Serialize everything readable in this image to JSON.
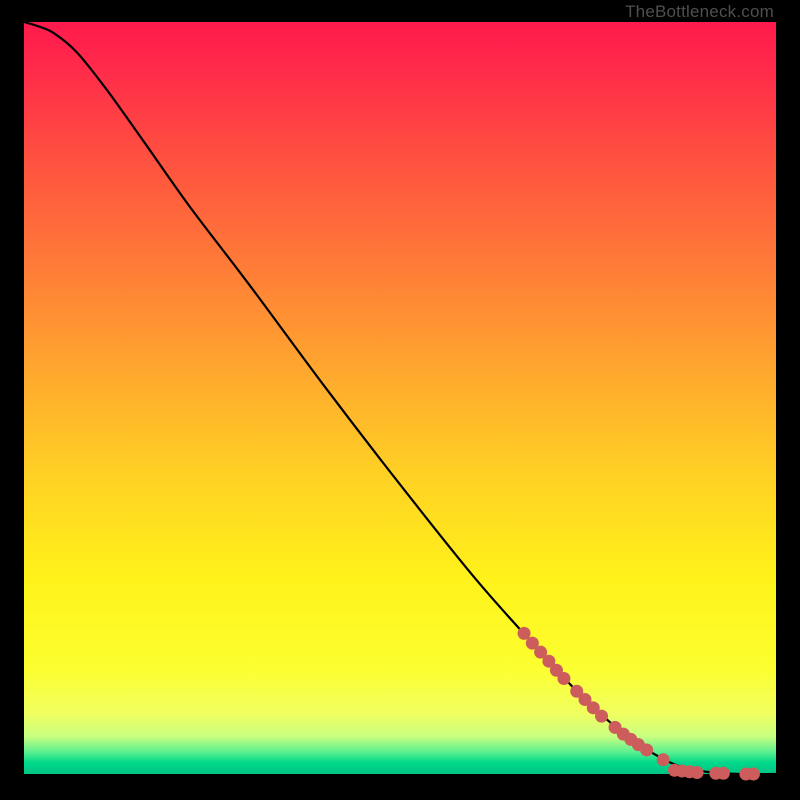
{
  "attribution": "TheBottleneck.com",
  "colors": {
    "marker": "#cd5c5c",
    "curve": "#000000",
    "gradient_top": "#ff1a4d",
    "gradient_bottom": "#00c484",
    "background": "#000000"
  },
  "chart_data": {
    "type": "line",
    "title": "",
    "xlabel": "",
    "ylabel": "",
    "xlim": [
      0,
      100
    ],
    "ylim": [
      0,
      100
    ],
    "grid": false,
    "legend": false,
    "curve_points": [
      {
        "x": 0.0,
        "y": 100.0
      },
      {
        "x": 2.0,
        "y": 99.4
      },
      {
        "x": 4.0,
        "y": 98.5
      },
      {
        "x": 7.0,
        "y": 96.0
      },
      {
        "x": 11.0,
        "y": 91.0
      },
      {
        "x": 16.0,
        "y": 84.0
      },
      {
        "x": 22.0,
        "y": 75.5
      },
      {
        "x": 30.0,
        "y": 65.0
      },
      {
        "x": 40.0,
        "y": 51.5
      },
      {
        "x": 50.0,
        "y": 38.5
      },
      {
        "x": 60.0,
        "y": 26.0
      },
      {
        "x": 68.0,
        "y": 17.0
      },
      {
        "x": 75.0,
        "y": 9.5
      },
      {
        "x": 81.0,
        "y": 4.5
      },
      {
        "x": 86.0,
        "y": 1.5
      },
      {
        "x": 90.0,
        "y": 0.4
      },
      {
        "x": 95.0,
        "y": 0.0
      },
      {
        "x": 100.0,
        "y": 0.0
      }
    ],
    "markers": [
      {
        "x": 66.5,
        "y": 18.7
      },
      {
        "x": 67.6,
        "y": 17.4
      },
      {
        "x": 68.7,
        "y": 16.2
      },
      {
        "x": 69.8,
        "y": 15.0
      },
      {
        "x": 70.8,
        "y": 13.8
      },
      {
        "x": 71.8,
        "y": 12.7
      },
      {
        "x": 73.5,
        "y": 11.0
      },
      {
        "x": 74.6,
        "y": 9.9
      },
      {
        "x": 75.7,
        "y": 8.8
      },
      {
        "x": 76.8,
        "y": 7.7
      },
      {
        "x": 78.6,
        "y": 6.2
      },
      {
        "x": 79.7,
        "y": 5.3
      },
      {
        "x": 80.7,
        "y": 4.6
      },
      {
        "x": 81.7,
        "y": 3.9
      },
      {
        "x": 82.8,
        "y": 3.2
      },
      {
        "x": 85.0,
        "y": 1.9
      },
      {
        "x": 86.5,
        "y": 0.5
      },
      {
        "x": 87.5,
        "y": 0.4
      },
      {
        "x": 88.5,
        "y": 0.3
      },
      {
        "x": 89.5,
        "y": 0.2
      },
      {
        "x": 92.0,
        "y": 0.1
      },
      {
        "x": 93.0,
        "y": 0.1
      },
      {
        "x": 96.0,
        "y": 0.0
      },
      {
        "x": 97.0,
        "y": 0.0
      }
    ],
    "marker_radius_px": 6.5
  }
}
